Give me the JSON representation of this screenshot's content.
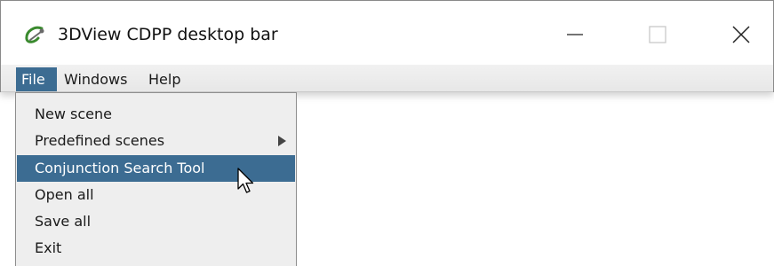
{
  "window": {
    "title": "3DView CDPP desktop bar",
    "icon": "3dview-app-icon",
    "controls": {
      "minimize": "minimize-icon",
      "maximize": "maximize-icon",
      "close": "close-icon"
    }
  },
  "menubar": {
    "items": [
      {
        "label": "File",
        "active": true
      },
      {
        "label": "Windows",
        "active": false
      },
      {
        "label": "Help",
        "active": false
      }
    ]
  },
  "file_menu": {
    "items": [
      {
        "label": "New scene",
        "has_submenu": false,
        "highlighted": false
      },
      {
        "label": "Predefined scenes",
        "has_submenu": true,
        "highlighted": false
      },
      {
        "label": "Conjunction Search Tool",
        "has_submenu": false,
        "highlighted": true
      },
      {
        "label": "Open all",
        "has_submenu": false,
        "highlighted": false
      },
      {
        "label": "Save all",
        "has_submenu": false,
        "highlighted": false
      },
      {
        "label": "Exit",
        "has_submenu": false,
        "highlighted": false
      }
    ]
  },
  "colors": {
    "highlight": "#3c6c92",
    "menu_background": "#eeeeee",
    "icon_green": "#3a8a2e"
  },
  "cursor": "arrow-pointer-icon"
}
